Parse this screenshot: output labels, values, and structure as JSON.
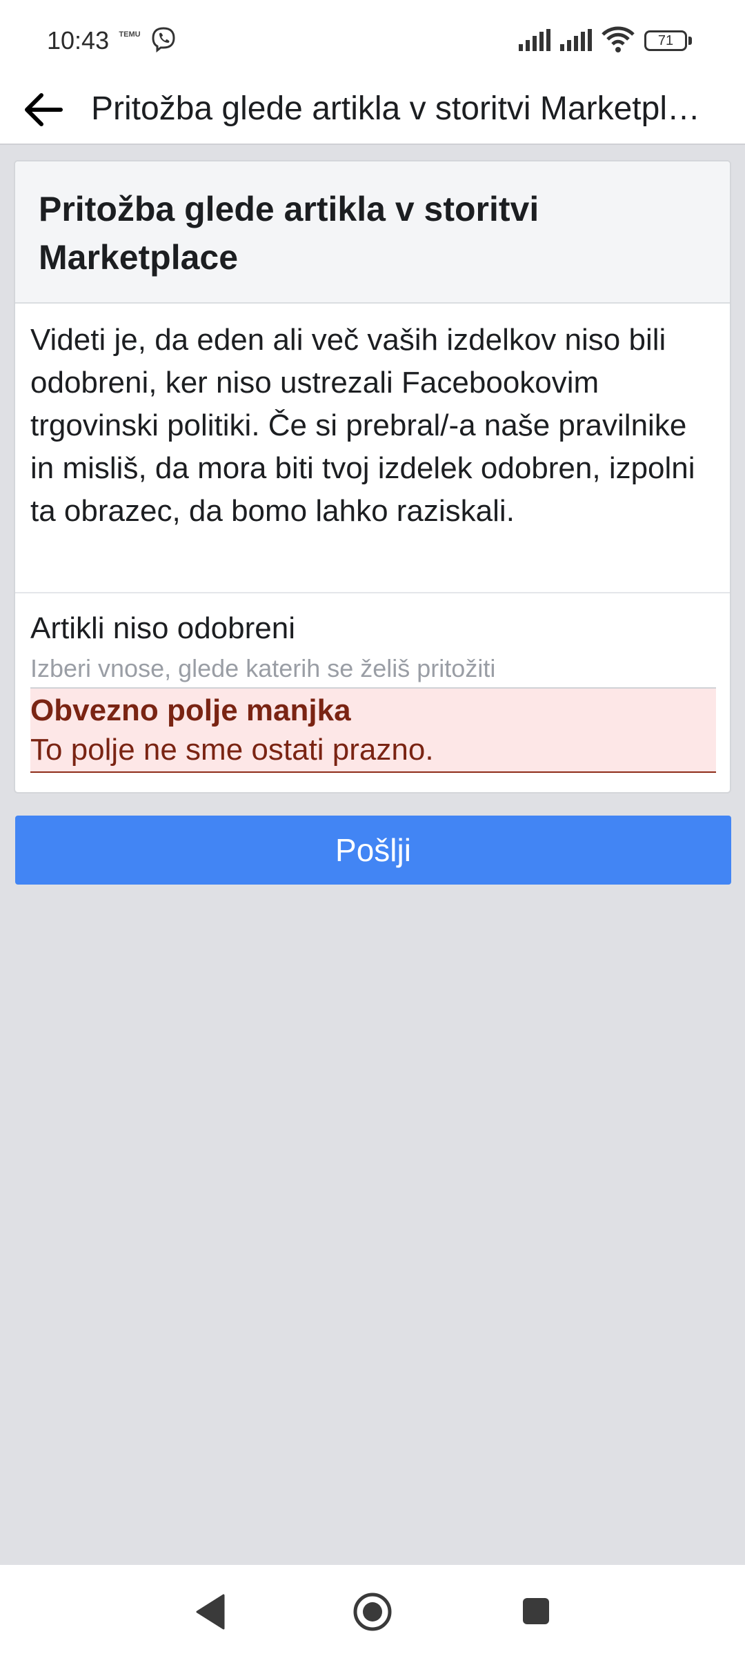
{
  "status_bar": {
    "time": "10:43",
    "notification_app": "TEMU",
    "battery_level": "71"
  },
  "app_bar": {
    "title": "Pritožba glede artikla v storitvi Marketplace"
  },
  "card": {
    "title_line1": "Pritožba glede artikla v storitvi",
    "title_line2": "Marketplace",
    "description": "Videti je, da eden ali več vaših izdelkov niso bili odobreni, ker niso ustrezali Facebookovim trgovinski politiki. Če si prebral/-a naše pravilnike in misliš, da mora biti tvoj izdelek odobren, izpolni ta obrazec, da bomo lahko raziskali.",
    "field": {
      "label": "Artikli niso odobreni",
      "placeholder": "Izberi vnose, glede katerih se želiš pritožiti",
      "value": ""
    },
    "error": {
      "title": "Obvezno polje manjka",
      "text": "To polje ne sme ostati prazno."
    }
  },
  "submit_label": "Pošlji",
  "colors": {
    "accent": "#4285f4",
    "error_bg": "#fde7e7",
    "error_text": "#7a2413",
    "page_bg": "#dfe0e4"
  },
  "icons": {
    "back": "back-arrow-icon",
    "viber": "viber-icon",
    "signal": "signal-icon",
    "wifi": "wifi-icon",
    "nav_back": "nav-back-icon",
    "nav_home": "nav-home-icon",
    "nav_recents": "nav-recents-icon"
  }
}
